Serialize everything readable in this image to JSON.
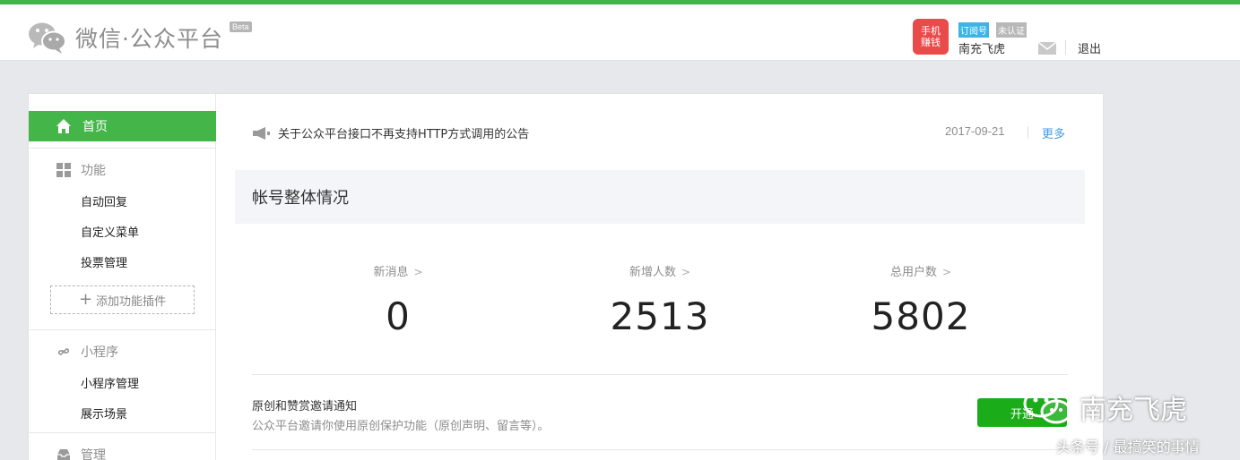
{
  "header": {
    "logo_text": "微信·公众平台",
    "beta_badge": "Beta",
    "avatar_text": "手机赚钱",
    "account_type": "订阅号",
    "verify_status": "未认证",
    "account_name": "南充飞虎",
    "logout_label": "退出",
    "icons": [
      "wechat-logo-icon",
      "mail-icon"
    ]
  },
  "sidebar": {
    "home_label": "首页",
    "groups": [
      {
        "label": "功能",
        "icon": "grid-icon",
        "items": [
          "自动回复",
          "自定义菜单",
          "投票管理"
        ]
      },
      {
        "label": "小程序",
        "icon": "link-icon",
        "items": [
          "小程序管理",
          "展示场景"
        ]
      },
      {
        "label": "管理",
        "icon": "inbox-icon",
        "items": []
      }
    ],
    "add_plugin_label": "添加功能插件"
  },
  "main": {
    "notice": {
      "text": "关于公众平台接口不再支持HTTP方式调用的公告",
      "date": "2017-09-21",
      "more_label": "更多"
    },
    "overview_title": "帐号整体情况",
    "stats": [
      {
        "label": "新消息",
        "value": "0"
      },
      {
        "label": "新增人数",
        "value": "2513"
      },
      {
        "label": "总用户数",
        "value": "5802"
      }
    ],
    "invite": {
      "title": "原创和赞赏邀请通知",
      "desc": "公众平台邀请你使用原创保护功能（原创声明、留言等）。",
      "button_label": "开通"
    }
  },
  "watermark": {
    "brand": "南充飞虎",
    "sub": "头条号 / 最搞笑的事情"
  },
  "colors": {
    "accent": "#44b549",
    "button": "#1aad19",
    "link": "#459ae9",
    "tag_subscription": "#3db3e6"
  }
}
